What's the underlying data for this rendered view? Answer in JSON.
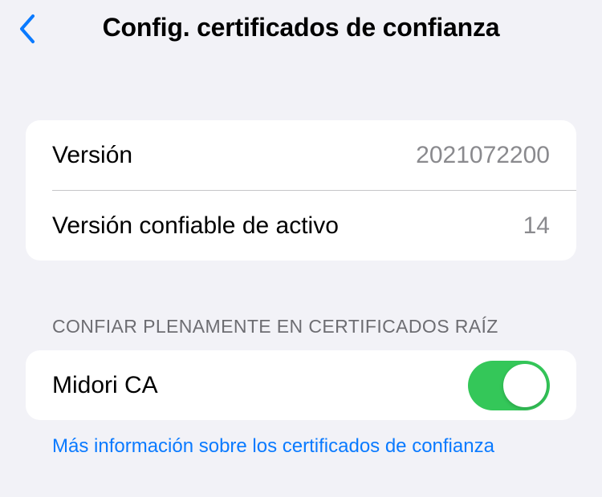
{
  "nav": {
    "title": "Config. certificados de confianza"
  },
  "info": {
    "rows": [
      {
        "label": "Versión",
        "value": "2021072200"
      },
      {
        "label": "Versión confiable de activo",
        "value": "14"
      }
    ]
  },
  "trust": {
    "section_header": "CONFIAR PLENAMENTE EN CERTIFICADOS RAÍZ",
    "certificates": [
      {
        "name": "Midori CA",
        "enabled": true
      }
    ]
  },
  "footer": {
    "link_text": "Más información sobre los certificados de confianza"
  },
  "icons": {
    "back": "chevron-left-icon"
  },
  "colors": {
    "background": "#f2f2f7",
    "card": "#ffffff",
    "accent": "#0a7aff",
    "toggle_on": "#34c759",
    "secondary_text": "#8a8a8e",
    "section_header": "#6d6d72"
  }
}
